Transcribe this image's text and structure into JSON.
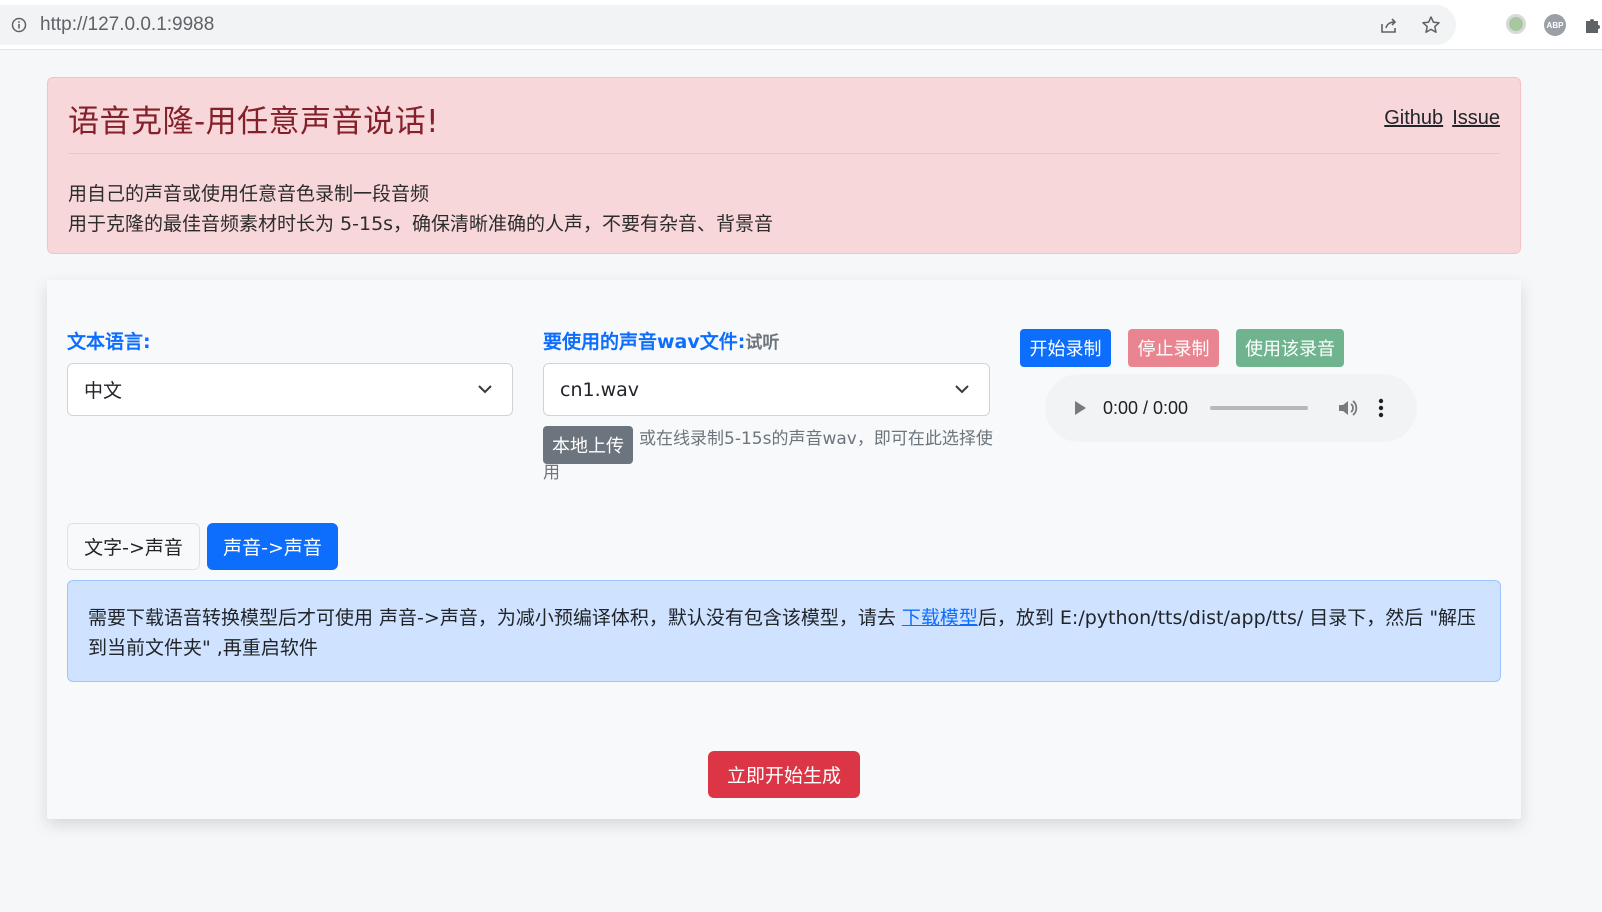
{
  "browser": {
    "url": "http://127.0.0.1:9988"
  },
  "header": {
    "title": "语音克隆-用任意声音说话!",
    "links": [
      "Github",
      "Issue"
    ],
    "line1": "用自己的声音或使用任意音色录制一段音频",
    "line2": "用于克隆的最佳音频素材时长为 5-15s，确保清晰准确的人声，不要有杂音、背景音"
  },
  "form": {
    "language_label": "文本语言:",
    "language_value": "中文",
    "voice_label": "要使用的声音wav文件:",
    "voice_sub": "试听",
    "voice_value": "cn1.wav",
    "upload_label": "本地上传",
    "upload_hint": "或在线录制5-15s的声音wav，即可在此选择使",
    "upload_hint_tail": "用",
    "record_start": "开始录制",
    "record_stop": "停止录制",
    "record_use": "使用该录音",
    "audio_time": "0:00 / 0:00"
  },
  "tabs": [
    "文字->声音",
    "声音->声音"
  ],
  "notice": {
    "before": "需要下载语音转换模型后才可使用 声音->声音，为减小预编译体积，默认没有包含该模型，请去 ",
    "link": "下载模型",
    "after": "后，放到 E:/python/tts/dist/app/tts/ 目录下，然后 \"解压到当前文件夹\" ,再重启软件"
  },
  "submit_label": "立即开始生成",
  "colors": {
    "primary": "#0d6efd",
    "danger": "#dc3545",
    "alert_bg": "#f8d7da",
    "info_bg": "#cfe2ff"
  }
}
